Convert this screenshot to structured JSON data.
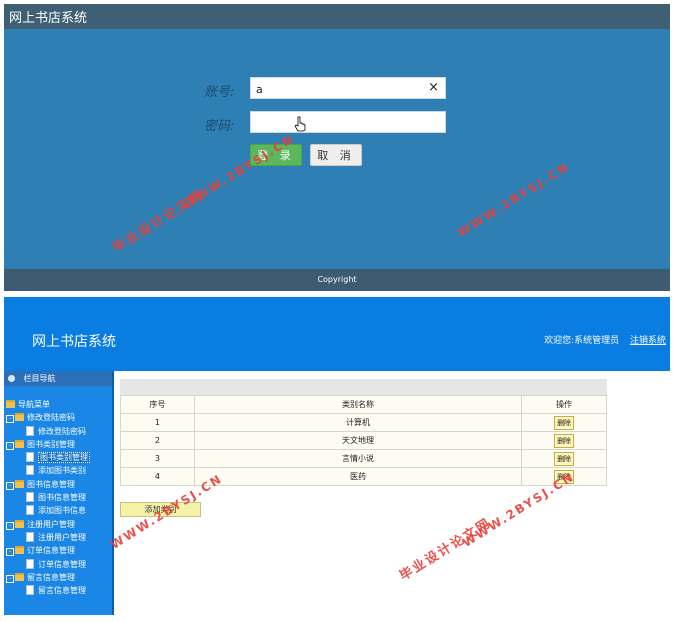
{
  "login": {
    "app_title": "网上书店系统",
    "account_label": "账号:",
    "account_value": "a",
    "password_label": "密码:",
    "password_value": "",
    "clear_icon": "×",
    "login_button": "登 录",
    "cancel_button": "取 消",
    "copyright": "Copyright"
  },
  "admin": {
    "app_title": "网上书店系统",
    "welcome_text": "欢迎您:系统管理员",
    "logout_link": "注销系统",
    "sidebar": {
      "header": "栏目导航",
      "root": "导航菜单",
      "groups": [
        {
          "label": "修改登陆密码",
          "children": [
            "修改登陆密码"
          ]
        },
        {
          "label": "图书类别管理",
          "children": [
            "图书类别管理",
            "添加图书类别"
          ]
        },
        {
          "label": "图书信息管理",
          "children": [
            "图书信息管理",
            "添加图书信息"
          ]
        },
        {
          "label": "注册用户管理",
          "children": [
            "注册用户管理"
          ]
        },
        {
          "label": "订单信息管理",
          "children": [
            "订单信息管理"
          ]
        },
        {
          "label": "留言信息管理",
          "children": [
            "留言信息管理"
          ]
        }
      ],
      "selected": "图书类别管理"
    },
    "table": {
      "headers": [
        "序号",
        "类别名称",
        "操作"
      ],
      "rows": [
        {
          "no": "1",
          "name": "计算机",
          "action": "删除"
        },
        {
          "no": "2",
          "name": "天文地理",
          "action": "删除"
        },
        {
          "no": "3",
          "name": "言情小说",
          "action": "删除"
        },
        {
          "no": "4",
          "name": "医药",
          "action": "删除"
        }
      ]
    },
    "add_button": "添加类别"
  },
  "watermarks": {
    "site": "WWW.2BYSJ.CN",
    "label": "毕业设计论文网"
  },
  "colors": {
    "login_bg": "#2e7fb3",
    "admin_header": "#0a7de3",
    "login_button": "#5cb85c",
    "watermark": "#e8413a"
  }
}
